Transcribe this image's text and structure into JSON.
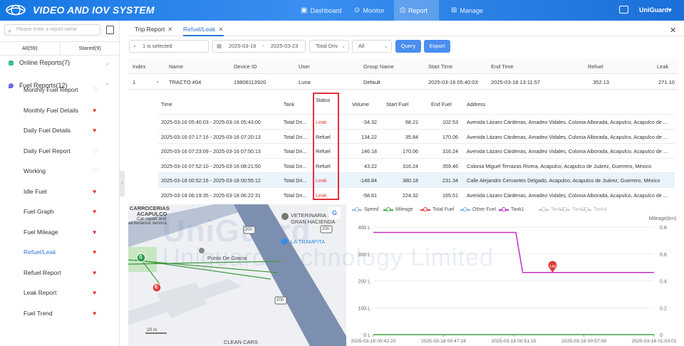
{
  "header": {
    "app_title": "VIDEO AND IOV SYSTEM",
    "nav": [
      {
        "label": "Dashboard",
        "icon": "dashboard-icon"
      },
      {
        "label": "Monitor",
        "icon": "location-pin-icon"
      },
      {
        "label": "Report",
        "icon": "report-icon"
      },
      {
        "label": "Manage",
        "icon": "grid-icon"
      }
    ],
    "active_nav": "Report",
    "user": "UniGuard▾"
  },
  "sidebar": {
    "search_placeholder": "Please enter a report name",
    "tabs": [
      {
        "label": "All(59)"
      },
      {
        "label": "Stared(9)"
      }
    ],
    "groups": [
      {
        "label": "Online Reports(7)",
        "icon_color": "#36c28a",
        "expanded": false
      },
      {
        "label": "Fuel Reports(12)",
        "icon_color": "#6d6ae8",
        "expanded": true
      }
    ],
    "items": [
      {
        "label": "Monthly Fuel Report",
        "starred": false
      },
      {
        "label": "Monthly Fuel Details",
        "starred": true
      },
      {
        "label": "Daily Fuel Details",
        "starred": true
      },
      {
        "label": "Daily Fuel Report",
        "starred": false
      },
      {
        "label": "Working",
        "starred": false
      },
      {
        "label": "Idle Fuel",
        "starred": true
      },
      {
        "label": "Fuel Graph",
        "starred": true
      },
      {
        "label": "Fuel Mileage",
        "starred": true
      },
      {
        "label": "Refuel/Leak",
        "starred": true,
        "active": true
      },
      {
        "label": "Refuel Report",
        "starred": true
      },
      {
        "label": "Leak Report",
        "starred": true
      },
      {
        "label": "Fuel Trend",
        "starred": true
      }
    ]
  },
  "tabs": [
    {
      "label": "Trip Report"
    },
    {
      "label": "Refuel/Leak",
      "active": true
    }
  ],
  "filters": {
    "selected": "1 is selected",
    "date_start": "2025-03-16",
    "date_sep": "-",
    "date_end": "2025-03-23",
    "tank_select": "Total Driv",
    "type_select": "All",
    "query_label": "Query",
    "export_label": "Export"
  },
  "table": {
    "headers": [
      "Index",
      "Name",
      "Device ID",
      "User",
      "Group Name",
      "Start Time",
      "End Time",
      "Refuel",
      "Leak"
    ],
    "row": {
      "index": "1",
      "name": "TRACTO #04",
      "device_id": "19808113920",
      "user": "Luna",
      "group": "Default",
      "start": "2025-03-16 05:40:03",
      "end": "2025-03-18 13:11:57",
      "refuel": "352.13",
      "leak": "271.10"
    }
  },
  "details": {
    "headers": [
      "Time",
      "Tank",
      "Status",
      "Volume",
      "Start Fuel",
      "End Fuel",
      "Address"
    ],
    "rows": [
      {
        "time": "2025-03-16 05:40:03 - 2025-03-16 05:43:00",
        "tank": "Total Dri...",
        "status": "Leak",
        "volume": "-34.32",
        "start": "68.21",
        "end": "102.53",
        "address": "Avenida Lázaro Cárdenas, Amadeo Vidales, Colonia Alborada, Acapulco, Acapulco de ..."
      },
      {
        "time": "2025-03-16 07:17:16 - 2025-03-16 07:20:13",
        "tank": "Total Dri...",
        "status": "Refuel",
        "volume": "134.22",
        "start": "35.84",
        "end": "170.06",
        "address": "Avenida Lázaro Cárdenas, Amadeo Vidales, Colonia Alborada, Acapulco, Acapulco de ..."
      },
      {
        "time": "2025-03-16 07:23:09 - 2025-03-16 07:50:13",
        "tank": "Total Dri...",
        "status": "Refuel",
        "volume": "146.18",
        "start": "170.06",
        "end": "316.24",
        "address": "Avenida Lázaro Cárdenas, Amadeo Vidales, Colonia Alborada, Acapulco, Acapulco de ..."
      },
      {
        "time": "2025-03-16 07:52:10 - 2025-03-16 08:21:50",
        "tank": "Total Dri...",
        "status": "Refuel",
        "volume": "43.22",
        "start": "316.24",
        "end": "359.46",
        "address": "Colonia Miguel Terrazas Rivera, Acapulco, Acapulco de Juárez, Guerrero, México"
      },
      {
        "time": "2025-03-18 00:52:16 - 2025-03-18 00:55:12",
        "tank": "Total Dri...",
        "status": "Leak",
        "volume": "-148.84",
        "start": "380.18",
        "end": "231.34",
        "address": "Calle Alejandro Cervantes Delgado, Acapulco, Acapulco de Juárez, Guerrero, México"
      },
      {
        "time": "2025-03-18 06:19:35 - 2025-03-18 06:22:31",
        "tank": "Total Dri...",
        "status": "Leak",
        "volume": "-58.81",
        "start": "224.32",
        "end": "165.51",
        "address": "Avenida Lázaro Cárdenas, Amadeo Vidales, Colonia Alborada, Acapulco, Acapulco de ..."
      }
    ]
  },
  "map": {
    "labels": [
      "CARROCERIAS",
      "ACAPULCO",
      "Car repair and",
      "aintenance service",
      "VETERINARIA 1",
      "GRAN HACIENDA",
      "LA TRAMPITA",
      "Punto De Gracia",
      "CLEAN CARS",
      "200",
      "200",
      "200"
    ],
    "scale": "20 m",
    "markers": {
      "start": "S",
      "end": "E"
    },
    "google_badge": "G"
  },
  "watermark": {
    "line1": "UniGuard",
    "line2": "Uniguard Technology Limited"
  },
  "chart_data": {
    "type": "line",
    "legend": [
      {
        "name": "Speed",
        "color": "#8fb8e8",
        "visible": true
      },
      {
        "name": "Mileage",
        "color": "#3aa63a",
        "visible": true
      },
      {
        "name": "Total Fuel",
        "color": "#e23b3b",
        "visible": true
      },
      {
        "name": "Other Fuel",
        "color": "#74b6f0",
        "visible": true
      },
      {
        "name": "Tank1",
        "color": "#c630c6",
        "visible": true
      },
      {
        "name": "Tank2",
        "color": "#c8c8c8",
        "visible": false
      },
      {
        "name": "Tank3",
        "color": "#c8c8c8",
        "visible": false
      },
      {
        "name": "Tank4",
        "color": "#c8c8c8",
        "visible": false
      }
    ],
    "y_left": {
      "ticks": [
        "0 L",
        "100 L",
        "200 L",
        "300 L",
        "400 L"
      ],
      "range": [
        0,
        400
      ]
    },
    "y_right": {
      "label": "Mileage(km)",
      "ticks": [
        "0",
        "0.2",
        "0.4",
        "0.6",
        "0.8"
      ],
      "range": [
        0,
        0.8
      ]
    },
    "x_ticks": [
      "2025-03-18 00:42:20",
      "2025-03-18 00:47:24",
      "2025-03-18 00:51:15",
      "2025-03-18 00:57:08",
      "2025-03-18 01:03:01"
    ],
    "x_range_min": [
      0,
      20.68
    ],
    "series": [
      {
        "name": "Tank1",
        "color": "#c630c6",
        "x_min": [
          0,
          10.5,
          11.0,
          20.68
        ],
        "y": [
          380,
          380,
          231,
          231
        ]
      },
      {
        "name": "Mileage",
        "color": "#3aa63a",
        "x_min": [
          0,
          20.68
        ],
        "y": [
          0.0,
          0.0
        ]
      }
    ],
    "marker": {
      "label": "149",
      "x_min": 13.2,
      "y": 231,
      "color": "#e23b3b"
    }
  }
}
